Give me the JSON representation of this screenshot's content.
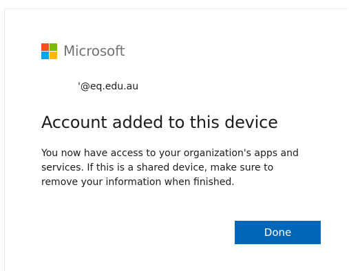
{
  "brand": {
    "name": "Microsoft",
    "icon": "microsoft-logo-icon",
    "colors": [
      "#f25022",
      "#7fba00",
      "#00a4ef",
      "#ffb900"
    ]
  },
  "account": {
    "email": "'@eq.edu.au"
  },
  "heading": "Account added to this device",
  "body": {
    "line1": "You now have access to your organization's apps and",
    "line2": "services. If this is a shared device, make sure to",
    "line3": "remove your information when finished."
  },
  "actions": {
    "done_label": "Done",
    "accent_color": "#0067b8"
  }
}
